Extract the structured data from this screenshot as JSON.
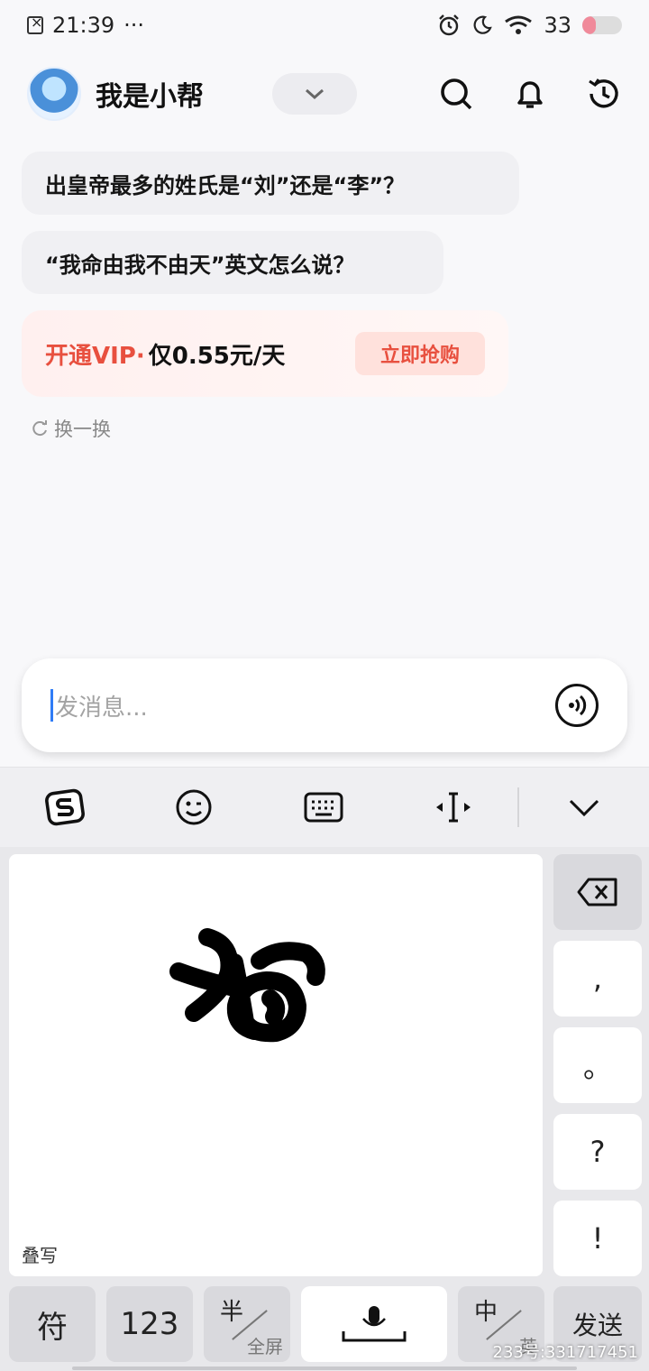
{
  "status_bar": {
    "time": "21:39",
    "more": "···",
    "battery": "33",
    "battery_level": 0.33
  },
  "header": {
    "assistant_name": "我是小帮"
  },
  "suggestions": [
    {
      "text": "出皇帝最多的姓氏是“刘”还是“李”？"
    },
    {
      "text": "“我命由我不由天”英文怎么说？"
    }
  ],
  "vip": {
    "tag": "开通VIP·",
    "price": "仅0.55元/天",
    "button": "立即抢购"
  },
  "refresh": {
    "label": "换一换"
  },
  "input": {
    "placeholder": "发消息..."
  },
  "keyboard": {
    "handwriting_mode": "叠写",
    "punctuation": [
      ",",
      "。",
      "?",
      "!"
    ],
    "bottom": {
      "symbols": "符",
      "numbers": "123",
      "half": "半",
      "fullscreen": "全屏",
      "chinese": "中",
      "english": "英",
      "send": "发送"
    }
  },
  "watermark": "233号:331717451",
  "colors": {
    "accent_red": "#e8503f",
    "caret_blue": "#2f7cf6"
  }
}
